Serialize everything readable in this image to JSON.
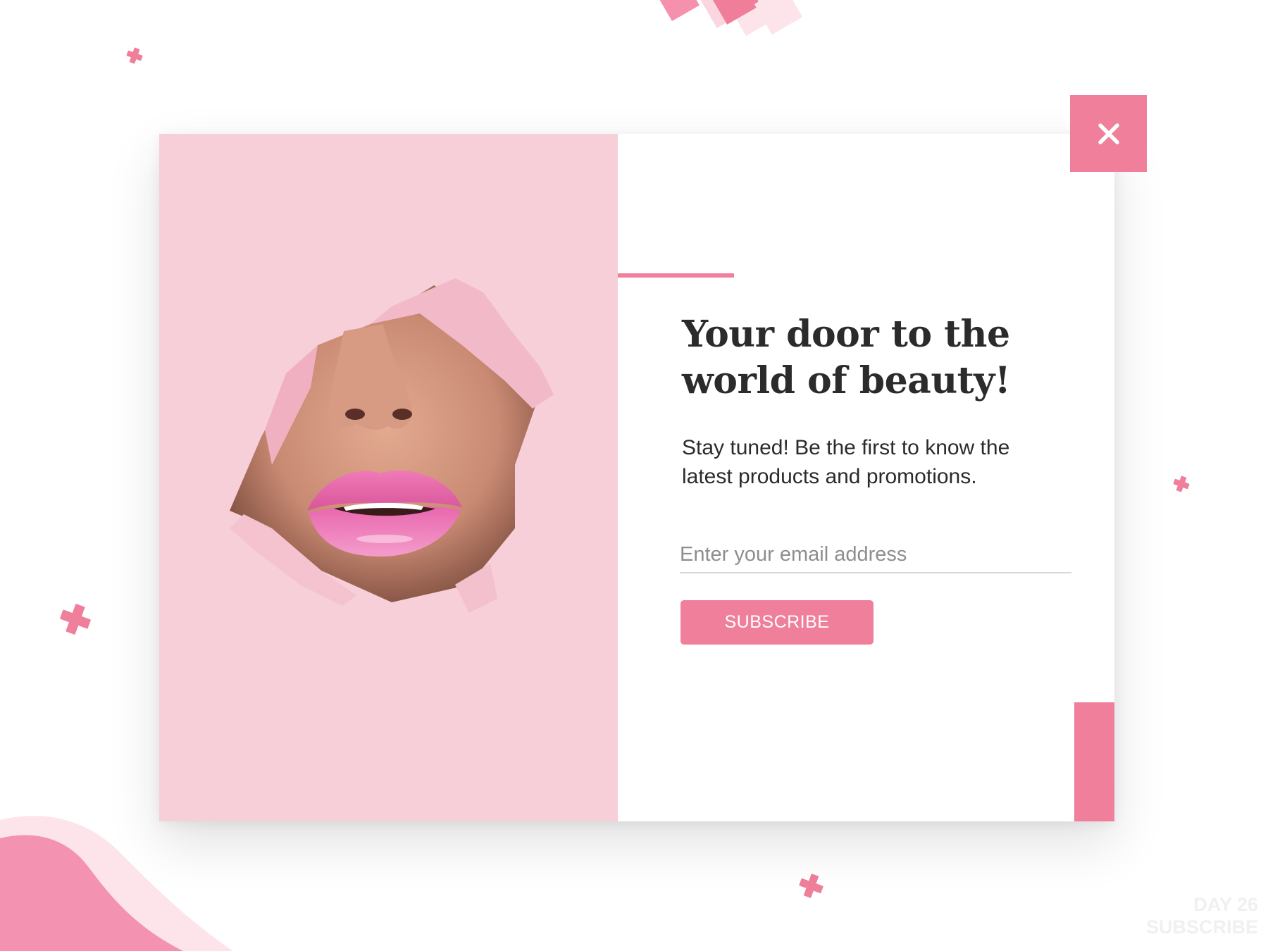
{
  "popup": {
    "headline": "Your door to the world of beauty!",
    "subtext": "Stay tuned! Be the first to know the latest products and promotions.",
    "email_placeholder": "Enter your email address",
    "subscribe_label": "SUBSCRIBE",
    "close_label": "X"
  },
  "watermark": {
    "line1": "DAY 26",
    "line2": "SUBSCRIBE"
  },
  "colors": {
    "accent": "#ef7f9b",
    "photo_background": "#f6cfd8",
    "text": "#2b2b2b",
    "placeholder": "#8e8e8e"
  },
  "icons": {
    "close": "close-icon",
    "decor": "plus-decor-icon"
  }
}
